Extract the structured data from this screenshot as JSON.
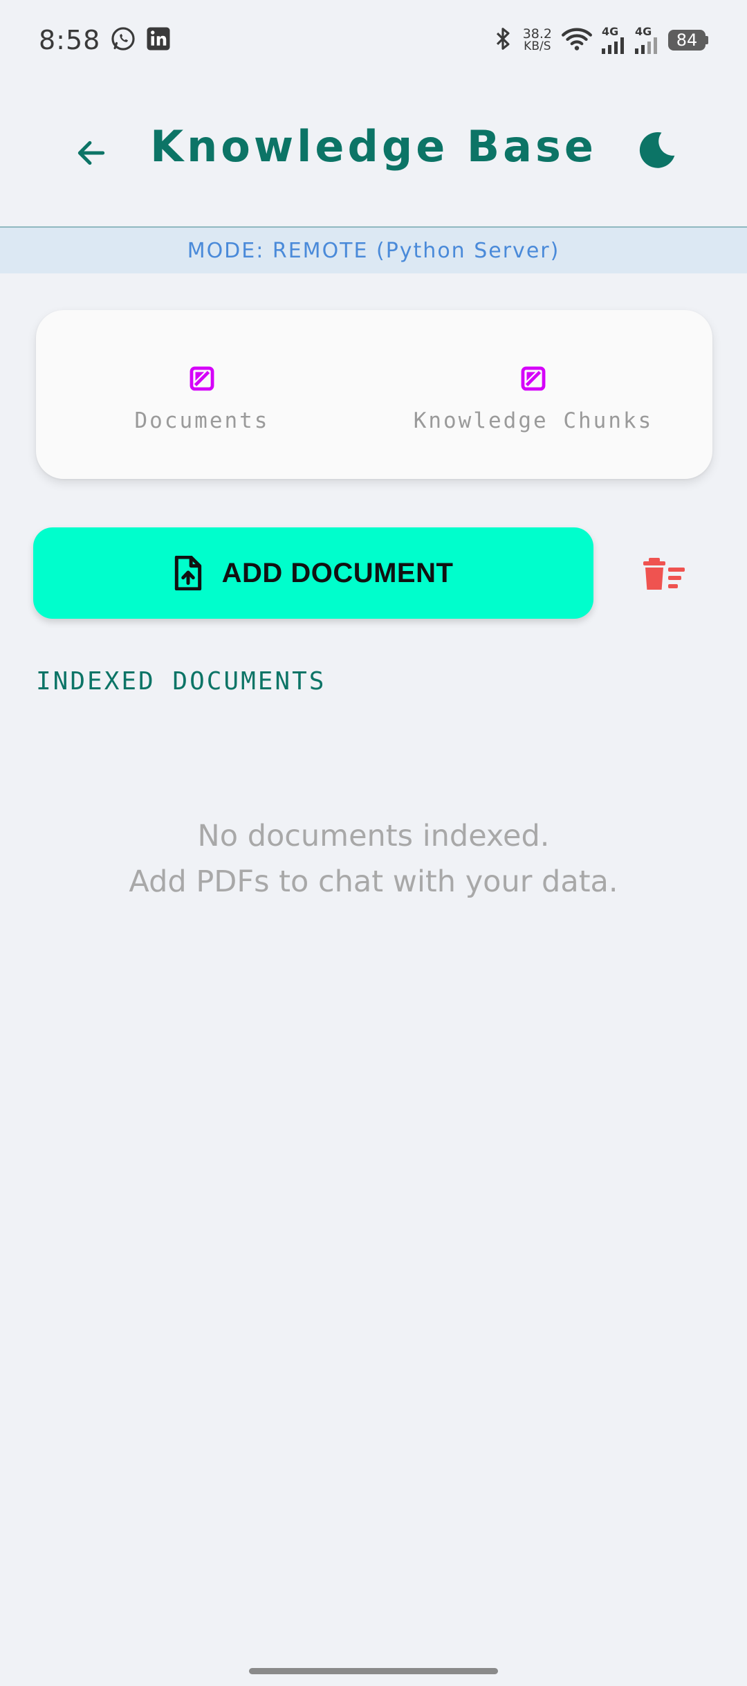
{
  "status_bar": {
    "time": "8:58",
    "net_speed_value": "38.2",
    "net_speed_unit": "KB/S",
    "sim1_label": "4G",
    "sim2_label": "4G",
    "battery": "84",
    "icons": [
      "whatsapp-icon",
      "linkedin-icon",
      "bluetooth-icon",
      "wifi-icon",
      "signal-icon",
      "battery-icon"
    ]
  },
  "app_bar": {
    "title": "Knowledge Base",
    "back_icon": "arrow-left-icon",
    "theme_icon": "moon-icon"
  },
  "mode_banner": {
    "text": "MODE: REMOTE (Python Server)"
  },
  "stats": {
    "documents_label": "Documents",
    "chunks_label": "Knowledge Chunks",
    "icon": "broken-value-icon"
  },
  "actions": {
    "add_label": "ADD DOCUMENT",
    "add_icon": "file-upload-icon",
    "clear_icon": "delete-sweep-icon"
  },
  "list": {
    "heading": "INDEXED DOCUMENTS",
    "empty_line1": "No documents indexed.",
    "empty_line2": "Add PDFs to chat with your data."
  },
  "colors": {
    "accent": "#0c7466",
    "button": "#00fecc",
    "danger": "#ef5350",
    "stat_icon": "#d500f9",
    "mode_text": "#4a8ad9",
    "background": "#f0f2f6"
  }
}
